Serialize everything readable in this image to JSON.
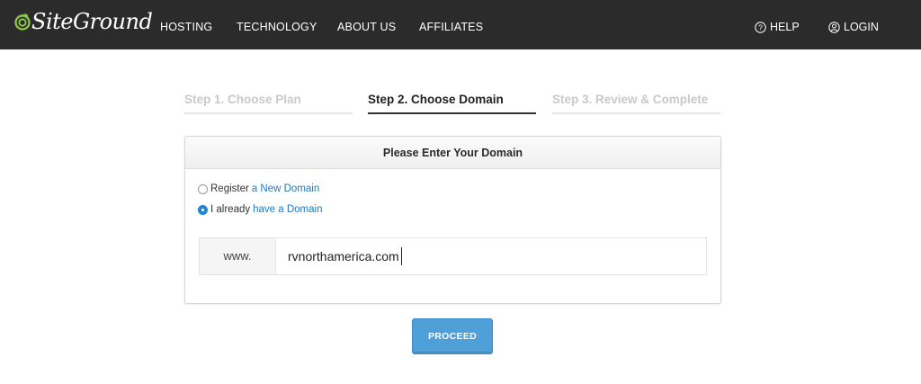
{
  "brand": {
    "name": "SiteGround",
    "logo_color": "#8bc34a"
  },
  "nav": {
    "items": [
      {
        "label": "HOSTING"
      },
      {
        "label": "TECHNOLOGY"
      },
      {
        "label": "ABOUT US"
      },
      {
        "label": "AFFILIATES"
      }
    ],
    "help": {
      "label": "HELP",
      "icon": "question-circle-icon"
    },
    "login": {
      "label": "LOGIN",
      "icon": "user-circle-icon"
    }
  },
  "steps": [
    {
      "label": "Step 1. Choose Plan",
      "state": "inactive"
    },
    {
      "label": "Step 2. Choose Domain",
      "state": "active"
    },
    {
      "label": "Step 3. Review & Complete",
      "state": "inactive"
    }
  ],
  "card": {
    "title": "Please Enter Your Domain",
    "options": [
      {
        "prefix": "Register",
        "link": "a New Domain",
        "checked": false
      },
      {
        "prefix": "I already",
        "link": "have a Domain",
        "checked": true
      }
    ],
    "domain": {
      "prefix": "www.",
      "value": "rvnorthamerica.com"
    }
  },
  "proceed_label": "PROCEED",
  "colors": {
    "topbar": "#2b2b2b",
    "accent": "#1f86d6",
    "button": "#4f9fd9"
  }
}
